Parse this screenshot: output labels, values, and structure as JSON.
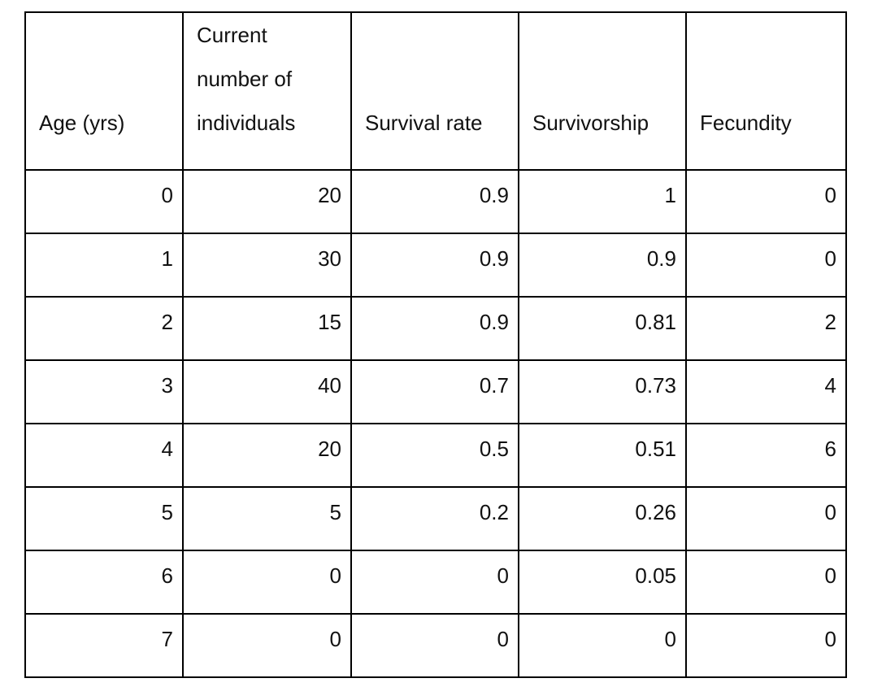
{
  "table": {
    "headers": [
      "Age (yrs)",
      "Current number of individuals",
      "Survival rate",
      "Survivorship",
      "Fecundity"
    ],
    "rows": [
      [
        "0",
        "20",
        "0.9",
        "1",
        "0"
      ],
      [
        "1",
        "30",
        "0.9",
        "0.9",
        "0"
      ],
      [
        "2",
        "15",
        "0.9",
        "0.81",
        "2"
      ],
      [
        "3",
        "40",
        "0.7",
        "0.73",
        "4"
      ],
      [
        "4",
        "20",
        "0.5",
        "0.51",
        "6"
      ],
      [
        "5",
        "5",
        "0.2",
        "0.26",
        "0"
      ],
      [
        "6",
        "0",
        "0",
        "0.05",
        "0"
      ],
      [
        "7",
        "0",
        "0",
        "0",
        "0"
      ]
    ]
  }
}
